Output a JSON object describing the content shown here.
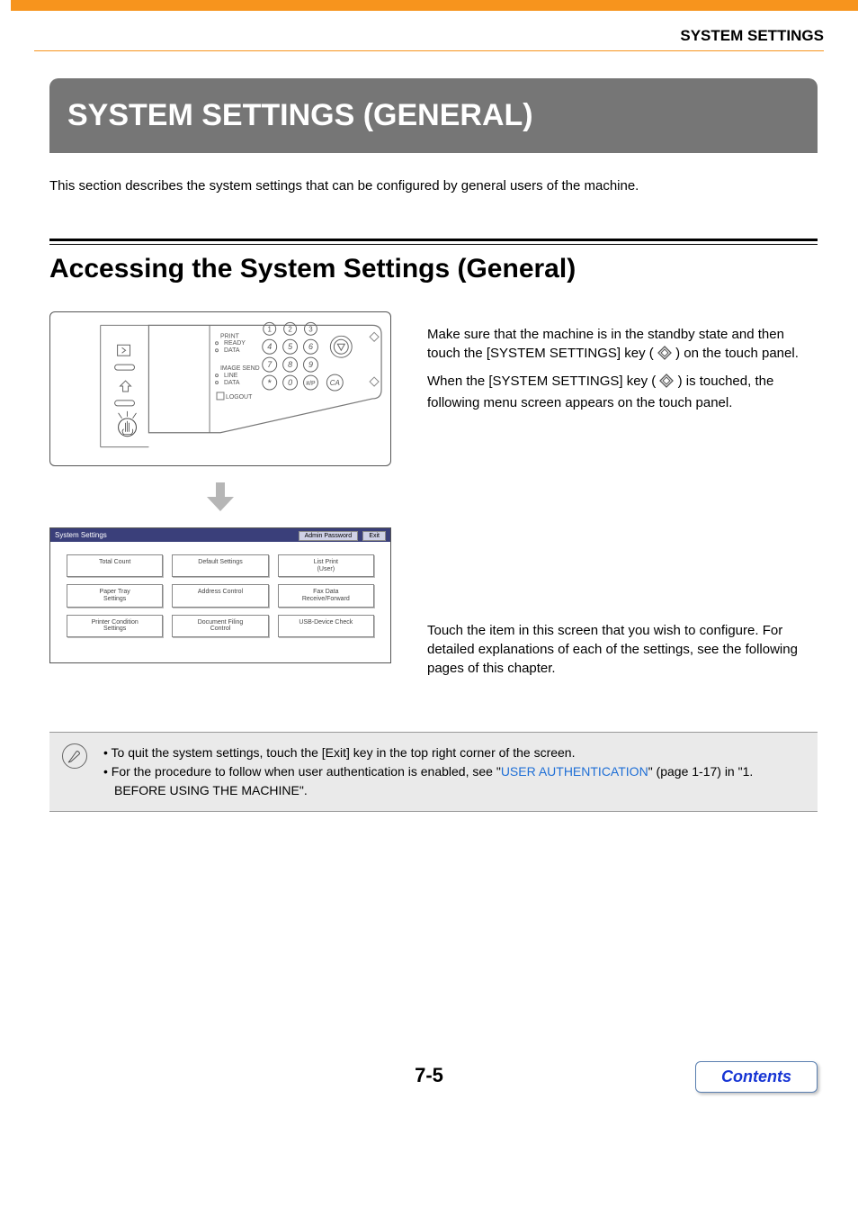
{
  "header": {
    "breadcrumb": "SYSTEM SETTINGS"
  },
  "title_banner": "SYSTEM SETTINGS (GENERAL)",
  "intro": "This section describes the system settings that can be configured by general users of the machine.",
  "section_title": "Accessing the System Settings (General)",
  "step1": {
    "p1a": "Make sure that the machine is in the standby state and then touch the [SYSTEM SETTINGS] key (",
    "p1b": ") on the touch panel.",
    "p2a": "When the [SYSTEM SETTINGS] key (",
    "p2b": ") is touched, the following menu screen appears on the touch panel."
  },
  "panel": {
    "labels": {
      "print": "PRINT",
      "ready": "READY",
      "data1": "DATA",
      "imagesend": "IMAGE SEND",
      "line": "LINE",
      "data2": "DATA",
      "logout": "LOGOUT"
    }
  },
  "screen": {
    "title": "System Settings",
    "admin_btn": "Admin Password",
    "exit_btn": "Exit",
    "buttons": [
      "Total Count",
      "Default Settings",
      "List Print\n(User)",
      "Paper Tray\nSettings",
      "Address Control",
      "Fax Data\nReceive/Forward",
      "Printer Condition\nSettings",
      "Document Filing\nControl",
      "USB-Device Check"
    ]
  },
  "step2": {
    "p1": "Touch the item in this screen that you wish to configure. For detailed explanations of each of the settings, see the following pages of this chapter."
  },
  "notes": {
    "item1": "To quit the system settings, touch the [Exit] key in the top right corner of the screen.",
    "item2a": "For the procedure to follow when user authentication is enabled, see \"",
    "item2_link": "USER AUTHENTICATION",
    "item2b": "\" (page 1-17) in \"1. BEFORE USING THE MACHINE\"."
  },
  "footer": {
    "page": "7-5",
    "contents": "Contents"
  }
}
